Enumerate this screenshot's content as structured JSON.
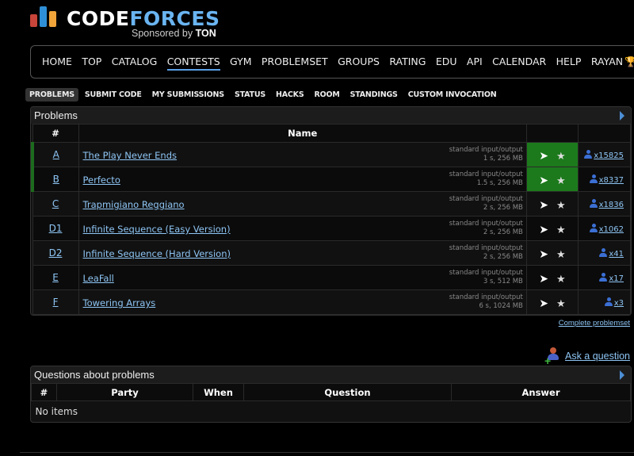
{
  "logo": {
    "code": "CODE",
    "forces": "FORCES",
    "sponsored_prefix": "Sponsored by",
    "sponsor": "TON"
  },
  "menu": {
    "items": [
      "HOME",
      "TOP",
      "CATALOG",
      "CONTESTS",
      "GYM",
      "PROBLEMSET",
      "GROUPS",
      "RATING",
      "EDU",
      "API",
      "CALENDAR",
      "HELP",
      "RAYAN"
    ],
    "active": "CONTESTS"
  },
  "submenu": {
    "items": [
      "PROBLEMS",
      "SUBMIT CODE",
      "MY SUBMISSIONS",
      "STATUS",
      "HACKS",
      "ROOM",
      "STANDINGS",
      "CUSTOM INVOCATION"
    ],
    "selected": "PROBLEMS"
  },
  "problems": {
    "title": "Problems",
    "headers": {
      "idx": "#",
      "name": "Name"
    },
    "rows": [
      {
        "idx": "A",
        "name": "The Play Never Ends",
        "io": "standard input/output",
        "limits": "1 s, 256 MB",
        "count": "x15825",
        "solved": true
      },
      {
        "idx": "B",
        "name": "Perfecto",
        "io": "standard input/output",
        "limits": "1.5 s, 256 MB",
        "count": "x8337",
        "solved": true
      },
      {
        "idx": "C",
        "name": "Trapmigiano Reggiano",
        "io": "standard input/output",
        "limits": "2 s, 256 MB",
        "count": "x1836",
        "solved": false
      },
      {
        "idx": "D1",
        "name": "Infinite Sequence (Easy Version)",
        "io": "standard input/output",
        "limits": "2 s, 256 MB",
        "count": "x1062",
        "solved": false
      },
      {
        "idx": "D2",
        "name": "Infinite Sequence (Hard Version)",
        "io": "standard input/output",
        "limits": "2 s, 256 MB",
        "count": "x41",
        "solved": false
      },
      {
        "idx": "E",
        "name": "LeaFall",
        "io": "standard input/output",
        "limits": "3 s, 512 MB",
        "count": "x17",
        "solved": false
      },
      {
        "idx": "F",
        "name": "Towering Arrays",
        "io": "standard input/output",
        "limits": "6 s, 1024 MB",
        "count": "x3",
        "solved": false
      }
    ],
    "complete_link": "Complete problemset"
  },
  "ask": {
    "label": "Ask a question"
  },
  "questions": {
    "title": "Questions about problems",
    "headers": {
      "idx": "#",
      "party": "Party",
      "when": "When",
      "question": "Question",
      "answer": "Answer"
    },
    "empty": "No items"
  },
  "colors": {
    "accent": "#8ec5f4",
    "solved": "#1c7a1c",
    "logo_red": "#c7453a",
    "logo_blue": "#2f8fd6",
    "logo_yellow": "#f0a43a"
  }
}
